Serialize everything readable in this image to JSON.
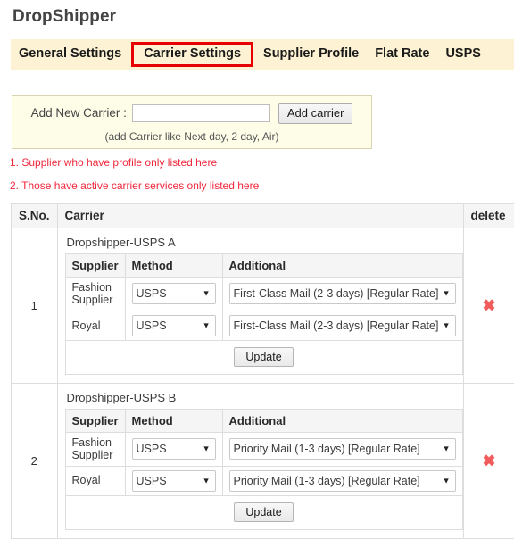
{
  "page": {
    "title": "DropShipper"
  },
  "tabs": [
    {
      "label": "General Settings",
      "active": false
    },
    {
      "label": "Carrier Settings",
      "active": true
    },
    {
      "label": "Supplier Profile",
      "active": false
    },
    {
      "label": "Flat Rate",
      "active": false
    },
    {
      "label": "USPS",
      "active": false
    }
  ],
  "add_carrier": {
    "label": "Add New Carrier :",
    "input_value": "",
    "input_placeholder": "",
    "button_label": "Add carrier",
    "hint": "(add Carrier like Next day, 2 day, Air)"
  },
  "notes": [
    "1. Supplier who have profile only listed here",
    "2. Those have active carrier services only listed here"
  ],
  "table": {
    "headers": {
      "sno": "S.No.",
      "carrier": "Carrier",
      "delete": "delete"
    },
    "inner_headers": {
      "supplier": "Supplier",
      "method": "Method",
      "additional": "Additional"
    },
    "update_label": "Update",
    "delete_icon": "✖",
    "rows": [
      {
        "sno": "1",
        "carrier_name": "Dropshipper-USPS A",
        "suppliers": [
          {
            "supplier": "Fashion Supplier",
            "method": "USPS",
            "additional": "First-Class Mail (2-3 days) [Regular Rate]"
          },
          {
            "supplier": "Royal",
            "method": "USPS",
            "additional": "First-Class Mail (2-3 days) [Regular Rate]"
          }
        ]
      },
      {
        "sno": "2",
        "carrier_name": "Dropshipper-USPS B",
        "suppliers": [
          {
            "supplier": "Fashion Supplier",
            "method": "USPS",
            "additional": "Priority Mail (1-3 days) [Regular Rate]"
          },
          {
            "supplier": "Royal",
            "method": "USPS",
            "additional": "Priority Mail (1-3 days) [Regular Rate]"
          }
        ]
      }
    ]
  },
  "colors": {
    "tabbar_bg": "#fdf3d4",
    "highlight_border": "#e60000",
    "panel_bg": "#fdfde8",
    "note_text": "#f0283c",
    "delete_icon": "#f25b5b"
  }
}
